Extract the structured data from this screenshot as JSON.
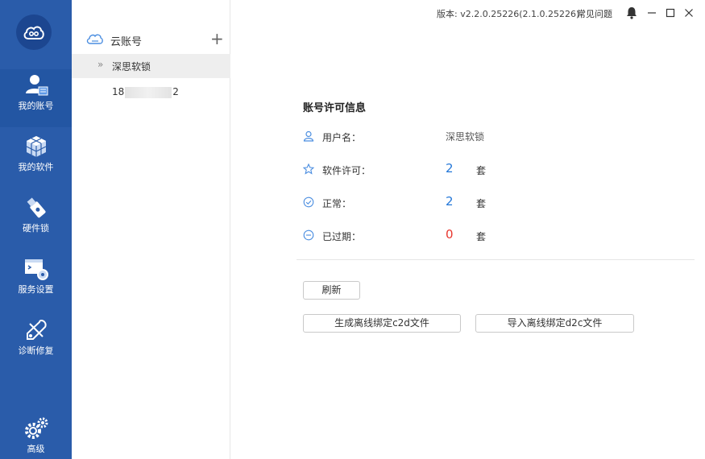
{
  "app": {
    "accent": "#2a5caa"
  },
  "nav": {
    "items": [
      {
        "label": "我的账号",
        "icon": "user-account-icon"
      },
      {
        "label": "我的软件",
        "icon": "software-cube-icon"
      },
      {
        "label": "硬件锁",
        "icon": "usb-dongle-icon"
      },
      {
        "label": "服务设置",
        "icon": "service-settings-icon"
      },
      {
        "label": "诊断修复",
        "icon": "diagnose-repair-icon"
      },
      {
        "label": "高级",
        "icon": "gears-icon"
      }
    ]
  },
  "accounts": {
    "title": "云账号",
    "add_symbol": "+",
    "items": [
      {
        "chevron": "»",
        "label": "深思软锁"
      },
      {
        "prefix": "18",
        "suffix": "2"
      }
    ]
  },
  "topbar": {
    "version": "版本: v2.2.0.25226(2.1.0.25226)",
    "faq": "常见问题"
  },
  "license": {
    "title": "账号许可信息",
    "username_label": "用户名：",
    "username_value": "深思软锁",
    "software_label": "软件许可：",
    "software_count": "2",
    "normal_label": "正常：",
    "normal_count": "2",
    "expired_label": "已过期：",
    "expired_count": "0",
    "unit": "套"
  },
  "actions": {
    "refresh": "刷新",
    "generate_c2d": "生成离线绑定c2d文件",
    "import_d2c": "导入离线绑定d2c文件"
  }
}
